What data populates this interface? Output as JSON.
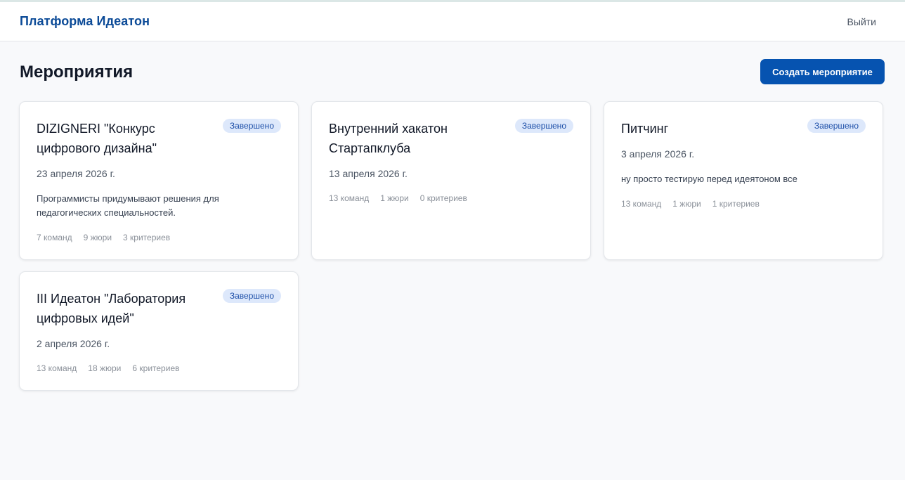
{
  "header": {
    "brand": "Платформа Идеатон",
    "logout": "Выйти"
  },
  "main": {
    "title": "Мероприятия",
    "create_button": "Создать мероприятие",
    "events": [
      {
        "title": "DIZIGNERI \"Конкурс цифрового дизайна\"",
        "status": "Завершено",
        "date": "23 апреля 2026 г.",
        "description": "Программисты придумывают решения для педагогических специальностей.",
        "teams": "7 команд",
        "jury": "9 жюри",
        "criteria": "3 критериев"
      },
      {
        "title": "Внутренний хакатон Стартапклуба",
        "status": "Завершено",
        "date": "13 апреля 2026 г.",
        "description": "",
        "teams": "13 команд",
        "jury": "1 жюри",
        "criteria": "0 критериев"
      },
      {
        "title": "Питчинг",
        "status": "Завершено",
        "date": "3 апреля 2026 г.",
        "description": "ну просто тестирую перед идеятоном все",
        "teams": "13 команд",
        "jury": "1 жюри",
        "criteria": "1 критериев"
      },
      {
        "title": "III Идеатон \"Лаборатория цифровых идей\"",
        "status": "Завершено",
        "date": "2 апреля 2026 г.",
        "description": "",
        "teams": "13 команд",
        "jury": "18 жюри",
        "criteria": "6 критериев"
      }
    ]
  },
  "colors": {
    "brand": "#0b4a97",
    "primary_button": "#0653b0",
    "badge_bg": "#dde8fb",
    "badge_text": "#1d4fa8",
    "page_bg": "#f8f9fb"
  }
}
